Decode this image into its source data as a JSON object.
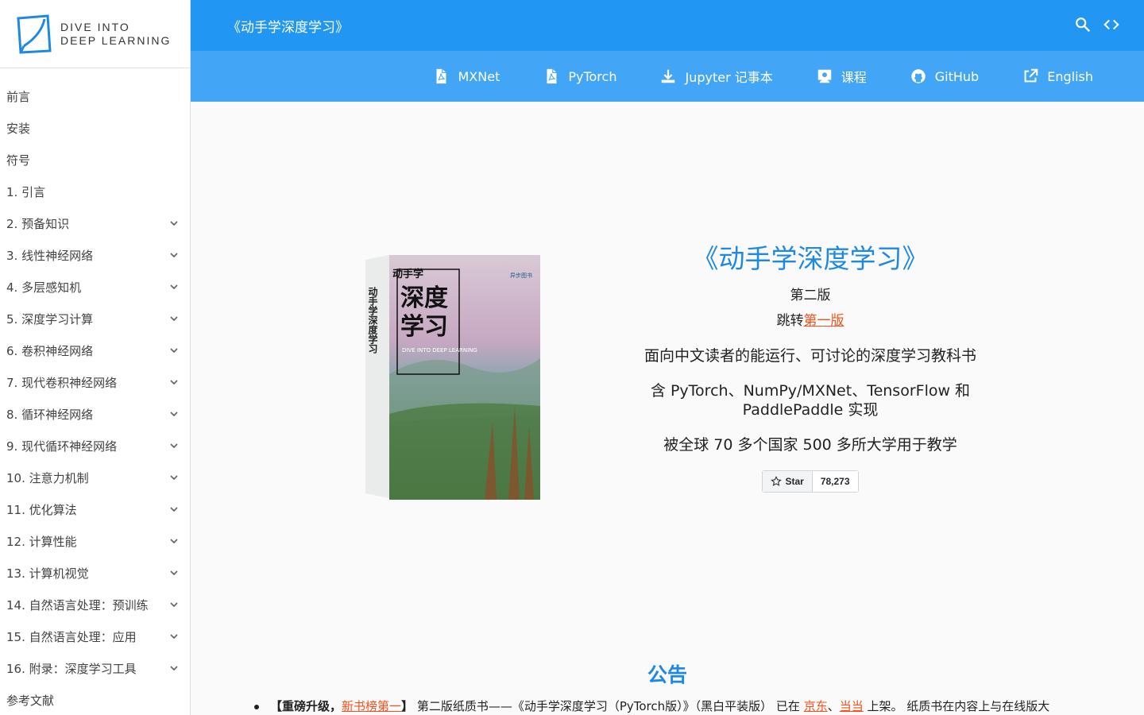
{
  "logo": {
    "line1": "DIVE INTO",
    "line2": "DEEP LEARNING"
  },
  "sidebar": {
    "items": [
      {
        "label": "前言",
        "expandable": false
      },
      {
        "label": "安装",
        "expandable": false
      },
      {
        "label": "符号",
        "expandable": false
      },
      {
        "label": "1. 引言",
        "expandable": false
      },
      {
        "label": "2. 预备知识",
        "expandable": true
      },
      {
        "label": "3. 线性神经网络",
        "expandable": true
      },
      {
        "label": "4. 多层感知机",
        "expandable": true
      },
      {
        "label": "5. 深度学习计算",
        "expandable": true
      },
      {
        "label": "6. 卷积神经网络",
        "expandable": true
      },
      {
        "label": "7. 现代卷积神经网络",
        "expandable": true
      },
      {
        "label": "8. 循环神经网络",
        "expandable": true
      },
      {
        "label": "9. 现代循环神经网络",
        "expandable": true
      },
      {
        "label": "10. 注意力机制",
        "expandable": true
      },
      {
        "label": "11. 优化算法",
        "expandable": true
      },
      {
        "label": "12. 计算性能",
        "expandable": true
      },
      {
        "label": "13. 计算机视觉",
        "expandable": true
      },
      {
        "label": "14. 自然语言处理：预训练",
        "expandable": true
      },
      {
        "label": "15. 自然语言处理：应用",
        "expandable": true
      },
      {
        "label": "16. 附录：深度学习工具",
        "expandable": true
      },
      {
        "label": "参考文献",
        "expandable": false
      }
    ]
  },
  "header": {
    "title": "《动手学深度学习》",
    "actions": [
      "search-icon",
      "code-icon"
    ]
  },
  "subnav": {
    "items": [
      {
        "label": "MXNet",
        "icon": "pdf-icon"
      },
      {
        "label": "PyTorch",
        "icon": "pdf-icon"
      },
      {
        "label": "Jupyter 记事本",
        "icon": "download-icon"
      },
      {
        "label": "课程",
        "icon": "teacher-icon"
      },
      {
        "label": "GitHub",
        "icon": "github-icon"
      },
      {
        "label": "English",
        "icon": "external-link-icon"
      }
    ]
  },
  "hero": {
    "title": "《动手学深度学习》",
    "edition": "第二版",
    "jump_prefix": "跳转",
    "jump_link": "第一版",
    "tagline": "面向中文读者的能运行、可讨论的深度学习教科书",
    "frameworks": "含 PyTorch、NumPy/MXNet、TensorFlow 和 PaddlePaddle 实现",
    "adoption": "被全球 70 多个国家 500 多所大学用于教学",
    "star_label": "Star",
    "star_count": "78,273"
  },
  "book_cover": {
    "brand": "动手学",
    "title_line1": "深度",
    "title_line2": "学习",
    "subtitle": "DIVE INTO DEEP LEARNING",
    "spine": "动手学深度学习",
    "badge": "异步图书"
  },
  "announcement": {
    "title": "公告",
    "bracket_open": "【",
    "bold": "重磅升级，",
    "link1": "新书榜第一",
    "bracket_close": "】",
    "text1": " 第二版纸质书——《动手学深度学习（PyTorch版）》（黑白平装版） 已在 ",
    "link2": "京东",
    "sep": "、",
    "link3": "当当",
    "text2": " 上架。 纸质书在内容上与在线版大"
  },
  "colors": {
    "header": "#2196f3",
    "subheader": "#42a5f5",
    "link": "#f4511e",
    "title": "#1e88e5"
  }
}
